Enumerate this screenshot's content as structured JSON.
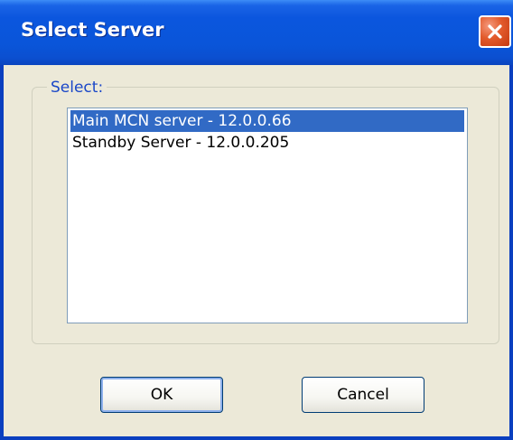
{
  "window": {
    "title": "Select Server",
    "close_icon": "close-icon"
  },
  "group": {
    "label": "Select:"
  },
  "servers": [
    {
      "label": "Main MCN server - 12.0.0.66",
      "selected": true
    },
    {
      "label": "Standby Server - 12.0.0.205",
      "selected": false
    }
  ],
  "buttons": {
    "ok_label": "OK",
    "cancel_label": "Cancel"
  },
  "colors": {
    "titlebar": "#0a55d9",
    "selection": "#316ac5",
    "group_label": "#1a47c8",
    "close_button": "#e25a2b",
    "dialog_background": "#ece9d8"
  }
}
